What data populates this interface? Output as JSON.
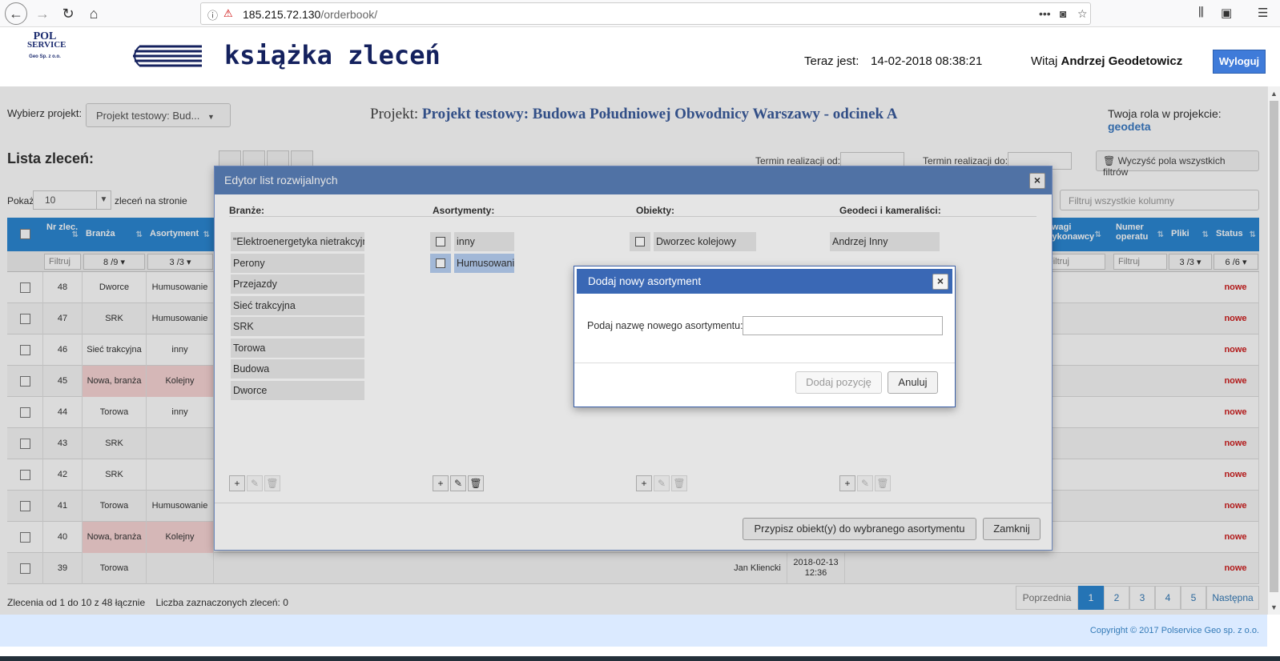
{
  "browser": {
    "url_host": "185.215.72.130",
    "url_path": "/orderbook/"
  },
  "header": {
    "logo_top": "POL",
    "logo_mid": "SERVICE",
    "logo_bottom": "Geo Sp. z o.o.",
    "app_title": "książka zleceń",
    "clock_label": "Teraz jest:",
    "clock_value": "14-02-2018 08:38:21",
    "greeting": "Witaj",
    "user_name": "Andrzej Geodetowicz",
    "logout_label": "Wyloguj"
  },
  "project": {
    "select_label": "Wybierz projekt:",
    "selected": "Projekt testowy: Bud...",
    "heading_label": "Projekt:",
    "heading_name": "Projekt testowy: Budowa Południowej Obwodnicy Warszawy - odcinek A",
    "role_label": "Twoja rola w projekcie:",
    "role_value": "geodeta"
  },
  "list": {
    "title": "Lista zleceń:",
    "date_from_label": "Termin realizacji od:",
    "date_to_label": "Termin realizacji do:",
    "clear_filters": "Wyczyść pola wszystkich filtrów",
    "show_label": "Pokaż",
    "page_size": "10",
    "show_suffix": "zleceń na stronie",
    "filter_all_placeholder": "Filtruj wszystkie kolumny"
  },
  "table": {
    "headers": {
      "nr": "Nr zlec.",
      "branza": "Branża",
      "asortyment": "Asortyment",
      "uwagi": "Uwagi wykonawcy",
      "numer": "Numer operatu",
      "pliki": "Pliki",
      "status": "Status"
    },
    "filters": {
      "nr": "Filtruj",
      "branza": "8 /9",
      "asortyment": "3 /3",
      "uwagi": "Filtruj",
      "numer": "Filtruj",
      "pliki": "3 /3",
      "status": "6 /6"
    },
    "rows": [
      {
        "nr": "48",
        "branza": "Dworce",
        "asortyment": "Humusowanie",
        "status": "nowe",
        "pink": false
      },
      {
        "nr": "47",
        "branza": "SRK",
        "asortyment": "Humusowanie",
        "status": "nowe",
        "pink": false
      },
      {
        "nr": "46",
        "branza": "Sieć trakcyjna",
        "asortyment": "inny",
        "status": "nowe",
        "pink": false
      },
      {
        "nr": "45",
        "branza": "Nowa, branża",
        "asortyment": "Kolejny",
        "status": "nowe",
        "pink": true
      },
      {
        "nr": "44",
        "branza": "Torowa",
        "asortyment": "inny",
        "status": "nowe",
        "pink": false
      },
      {
        "nr": "43",
        "branza": "SRK",
        "asortyment": "",
        "status": "nowe",
        "pink": false
      },
      {
        "nr": "42",
        "branza": "SRK",
        "asortyment": "",
        "status": "nowe",
        "pink": false
      },
      {
        "nr": "41",
        "branza": "Torowa",
        "asortyment": "Humusowanie",
        "status": "nowe",
        "pink": false
      },
      {
        "nr": "40",
        "branza": "Nowa, branża",
        "asortyment": "Kolejny",
        "status": "nowe",
        "pink": true
      },
      {
        "nr": "39",
        "branza": "Torowa",
        "asortyment": "",
        "status": "nowe",
        "pink": false,
        "person": "Jan Kliencki",
        "date": "2018-02-13",
        "time": "12:36"
      }
    ]
  },
  "footer_info": {
    "range": "Zlecenia od 1 do 10 z 48 łącznie",
    "selected": "Liczba zaznaczonych zleceń: 0"
  },
  "pager": {
    "prev": "Poprzednia",
    "pages": [
      "1",
      "2",
      "3",
      "4",
      "5"
    ],
    "next": "Następna"
  },
  "copyright": "Copyright © 2017 Polservice Geo sp. z o.o.",
  "editor": {
    "title": "Edytor list rozwijalnych",
    "col_branze": "Branże:",
    "col_asortymenty": "Asortymenty:",
    "col_obiekty": "Obiekty:",
    "col_geodeci": "Geodeci i kameraliści:",
    "branze": [
      "\"Elektroenergetyka nietrakcyjna",
      "Perony",
      "Przejazdy",
      "Sieć trakcyjna",
      "SRK",
      "Torowa",
      "Budowa",
      "Dworce"
    ],
    "asortymenty": [
      "inny",
      "Humusowanie"
    ],
    "obiekty": [
      "Dworzec kolejowy"
    ],
    "geodeci": [
      "Andrzej Inny"
    ],
    "assign_button": "Przypisz obiekt(y) do wybranego asortymentu",
    "close_button": "Zamknij"
  },
  "add_dialog": {
    "title": "Dodaj nowy asortyment",
    "label": "Podaj nazwę nowego asortymentu:",
    "input_value": "",
    "add_button": "Dodaj pozycję",
    "cancel_button": "Anuluj"
  },
  "colors": {
    "header_blue": "#2c87d3",
    "editor_head": "#5a7fb8",
    "dialog_head": "#3a68b5",
    "status_red": "#d02020",
    "pink_row": "#f8d6d6"
  }
}
